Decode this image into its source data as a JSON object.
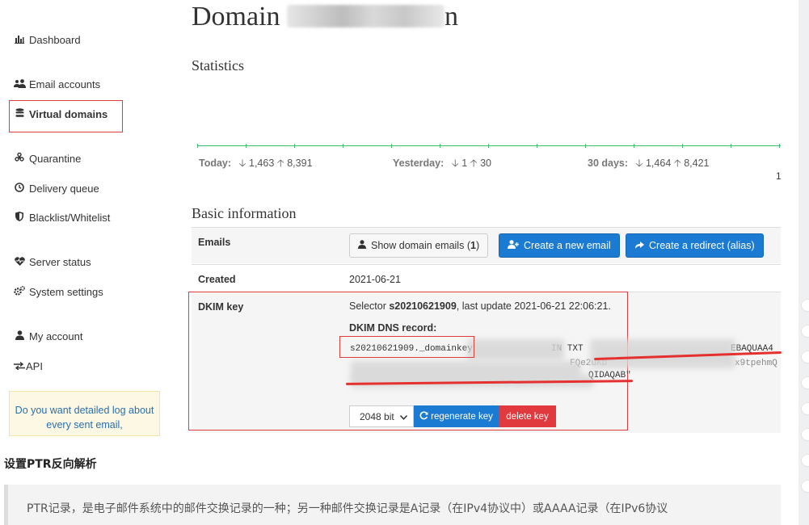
{
  "sidebar": {
    "items": [
      {
        "label": "Dashboard",
        "icon": "bar-chart-icon"
      },
      {
        "label": "Email accounts",
        "icon": "users-icon"
      },
      {
        "label": "Virtual domains",
        "icon": "database-icon",
        "active": true
      },
      {
        "label": "Quarantine",
        "icon": "biohazard-icon"
      },
      {
        "label": "Delivery queue",
        "icon": "clock-icon"
      },
      {
        "label": "Blacklist/Whitelist",
        "icon": "shield-icon"
      },
      {
        "label": "Server status",
        "icon": "heartbeat-icon"
      },
      {
        "label": "System settings",
        "icon": "gears-icon"
      },
      {
        "label": "My account",
        "icon": "user-icon"
      },
      {
        "label": "API",
        "icon": "exchange-icon"
      }
    ],
    "promo_text": "Do you want detailed log about every sent email,"
  },
  "page": {
    "title_prefix": "Domain",
    "title_suffix": "n"
  },
  "statistics": {
    "title": "Statistics",
    "today_label": "Today:",
    "today_down": "1,463",
    "today_up": "8,391",
    "yesterday_label": "Yesterday:",
    "yesterday_down": "1",
    "yesterday_up": "30",
    "days30_label": "30 days:",
    "days30_down": "1,464",
    "days30_up": "8,421",
    "page_number": "1"
  },
  "basic_info": {
    "title": "Basic information",
    "emails_label": "Emails",
    "show_emails_label": "Show domain emails",
    "show_emails_count": "1",
    "create_email_label": "Create a new email",
    "create_redirect_label": "Create a redirect (alias)",
    "created_label": "Created",
    "created_value": "2021-06-21",
    "dkim_label": "DKIM key",
    "selector_prefix": "Selector",
    "selector_value": "s20210621909",
    "last_update_text": ", last update 2021-06-21 22:06:21.",
    "dns_record_label": "DKIM DNS record:",
    "dns_host": "s20210621909._domainkey",
    "dns_type": "IN TXT",
    "dns_frag_1": "EBAQUAA4",
    "dns_frag_2": "FQe2uKb",
    "dns_frag_3": "x9tpehmQ",
    "dns_frag_4": "QIDAQAB\"",
    "key_size": "2048 bit",
    "regenerate_label": "regenerate key",
    "delete_label": "delete key"
  },
  "article": {
    "heading": "设置PTR反向解析",
    "quote": "PTR记录，是电子邮件系统中的邮件交换记录的一种；另一种邮件交换记录是A记录（在IPv4协议中）或AAAA记录（在IPv6协议"
  },
  "colors": {
    "accent_blue": "#1b7bd3",
    "danger_red": "#e0393e",
    "chart_green": "#3cbf6a",
    "annotation_red": "#e03c3c"
  }
}
